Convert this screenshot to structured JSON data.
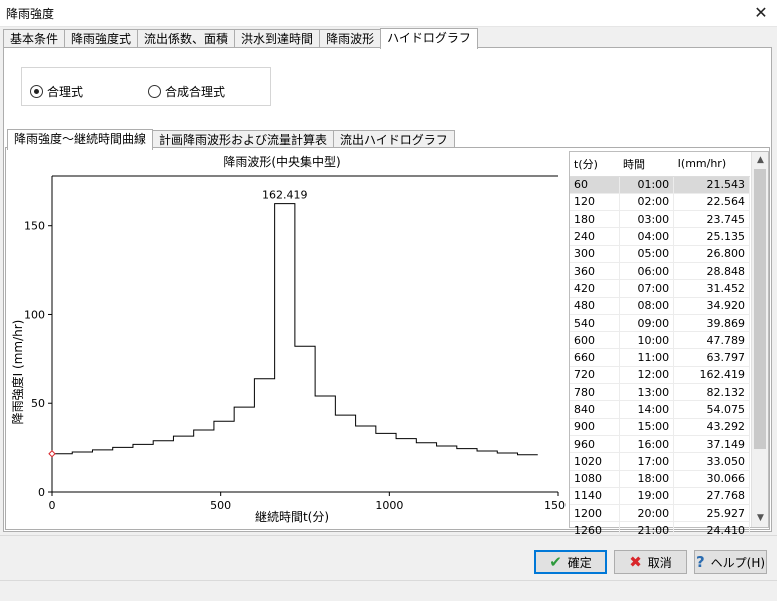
{
  "window": {
    "title": "降雨強度"
  },
  "tabs": [
    "基本条件",
    "降雨強度式",
    "流出係数、面積",
    "洪水到達時間",
    "降雨波形",
    "ハイドログラフ"
  ],
  "radio": {
    "opt1": "合理式",
    "opt2": "合成合理式"
  },
  "inner_tabs": [
    "降雨強度～継続時間曲線",
    "計画降雨波形および流量計算表",
    "流出ハイドログラフ"
  ],
  "table": {
    "headers": [
      "t(分)",
      "時間",
      "I(mm/hr)"
    ],
    "rows": [
      [
        "60",
        "01:00",
        "21.543"
      ],
      [
        "120",
        "02:00",
        "22.564"
      ],
      [
        "180",
        "03:00",
        "23.745"
      ],
      [
        "240",
        "04:00",
        "25.135"
      ],
      [
        "300",
        "05:00",
        "26.800"
      ],
      [
        "360",
        "06:00",
        "28.848"
      ],
      [
        "420",
        "07:00",
        "31.452"
      ],
      [
        "480",
        "08:00",
        "34.920"
      ],
      [
        "540",
        "09:00",
        "39.869"
      ],
      [
        "600",
        "10:00",
        "47.789"
      ],
      [
        "660",
        "11:00",
        "63.797"
      ],
      [
        "720",
        "12:00",
        "162.419"
      ],
      [
        "780",
        "13:00",
        "82.132"
      ],
      [
        "840",
        "14:00",
        "54.075"
      ],
      [
        "900",
        "15:00",
        "43.292"
      ],
      [
        "960",
        "16:00",
        "37.149"
      ],
      [
        "1020",
        "17:00",
        "33.050"
      ],
      [
        "1080",
        "18:00",
        "30.066"
      ],
      [
        "1140",
        "19:00",
        "27.768"
      ],
      [
        "1200",
        "20:00",
        "25.927"
      ],
      [
        "1260",
        "21:00",
        "24.410"
      ]
    ]
  },
  "chart_data": {
    "type": "line",
    "title": "降雨波形(中央集中型)",
    "xlabel": "継続時間t(分)",
    "ylabel": "降雨強度I (mm/hr)",
    "xlim": [
      0,
      1500
    ],
    "ylim": [
      0,
      178
    ],
    "xticks": [
      0,
      500,
      1000,
      1500
    ],
    "yticks": [
      0,
      50,
      100,
      150
    ],
    "peak_label": "162.419",
    "steps": [
      {
        "x0": 0,
        "x1": 60,
        "y": 21.543
      },
      {
        "x0": 60,
        "x1": 120,
        "y": 22.564
      },
      {
        "x0": 120,
        "x1": 180,
        "y": 23.745
      },
      {
        "x0": 180,
        "x1": 240,
        "y": 25.135
      },
      {
        "x0": 240,
        "x1": 300,
        "y": 26.8
      },
      {
        "x0": 300,
        "x1": 360,
        "y": 28.848
      },
      {
        "x0": 360,
        "x1": 420,
        "y": 31.452
      },
      {
        "x0": 420,
        "x1": 480,
        "y": 34.92
      },
      {
        "x0": 480,
        "x1": 540,
        "y": 39.869
      },
      {
        "x0": 540,
        "x1": 600,
        "y": 47.789
      },
      {
        "x0": 600,
        "x1": 660,
        "y": 63.797
      },
      {
        "x0": 660,
        "x1": 720,
        "y": 162.419
      },
      {
        "x0": 720,
        "x1": 780,
        "y": 82.132
      },
      {
        "x0": 780,
        "x1": 840,
        "y": 54.075
      },
      {
        "x0": 840,
        "x1": 900,
        "y": 43.292
      },
      {
        "x0": 900,
        "x1": 960,
        "y": 37.149
      },
      {
        "x0": 960,
        "x1": 1020,
        "y": 33.05
      },
      {
        "x0": 1020,
        "x1": 1080,
        "y": 30.066
      },
      {
        "x0": 1080,
        "x1": 1140,
        "y": 27.768
      },
      {
        "x0": 1140,
        "x1": 1200,
        "y": 25.927
      },
      {
        "x0": 1200,
        "x1": 1260,
        "y": 24.41
      },
      {
        "x0": 1260,
        "x1": 1320,
        "y": 23.1
      },
      {
        "x0": 1320,
        "x1": 1380,
        "y": 21.95
      },
      {
        "x0": 1380,
        "x1": 1440,
        "y": 20.95
      }
    ]
  },
  "buttons": {
    "ok": "確定",
    "cancel": "取消",
    "help": "ヘルプ(H)"
  },
  "colors": {
    "accent": "#0078d7",
    "ok_check": "#2e9a3c",
    "cancel_x": "#d9262b",
    "help_q": "#2b6cb0",
    "marker": "#d9262b"
  }
}
